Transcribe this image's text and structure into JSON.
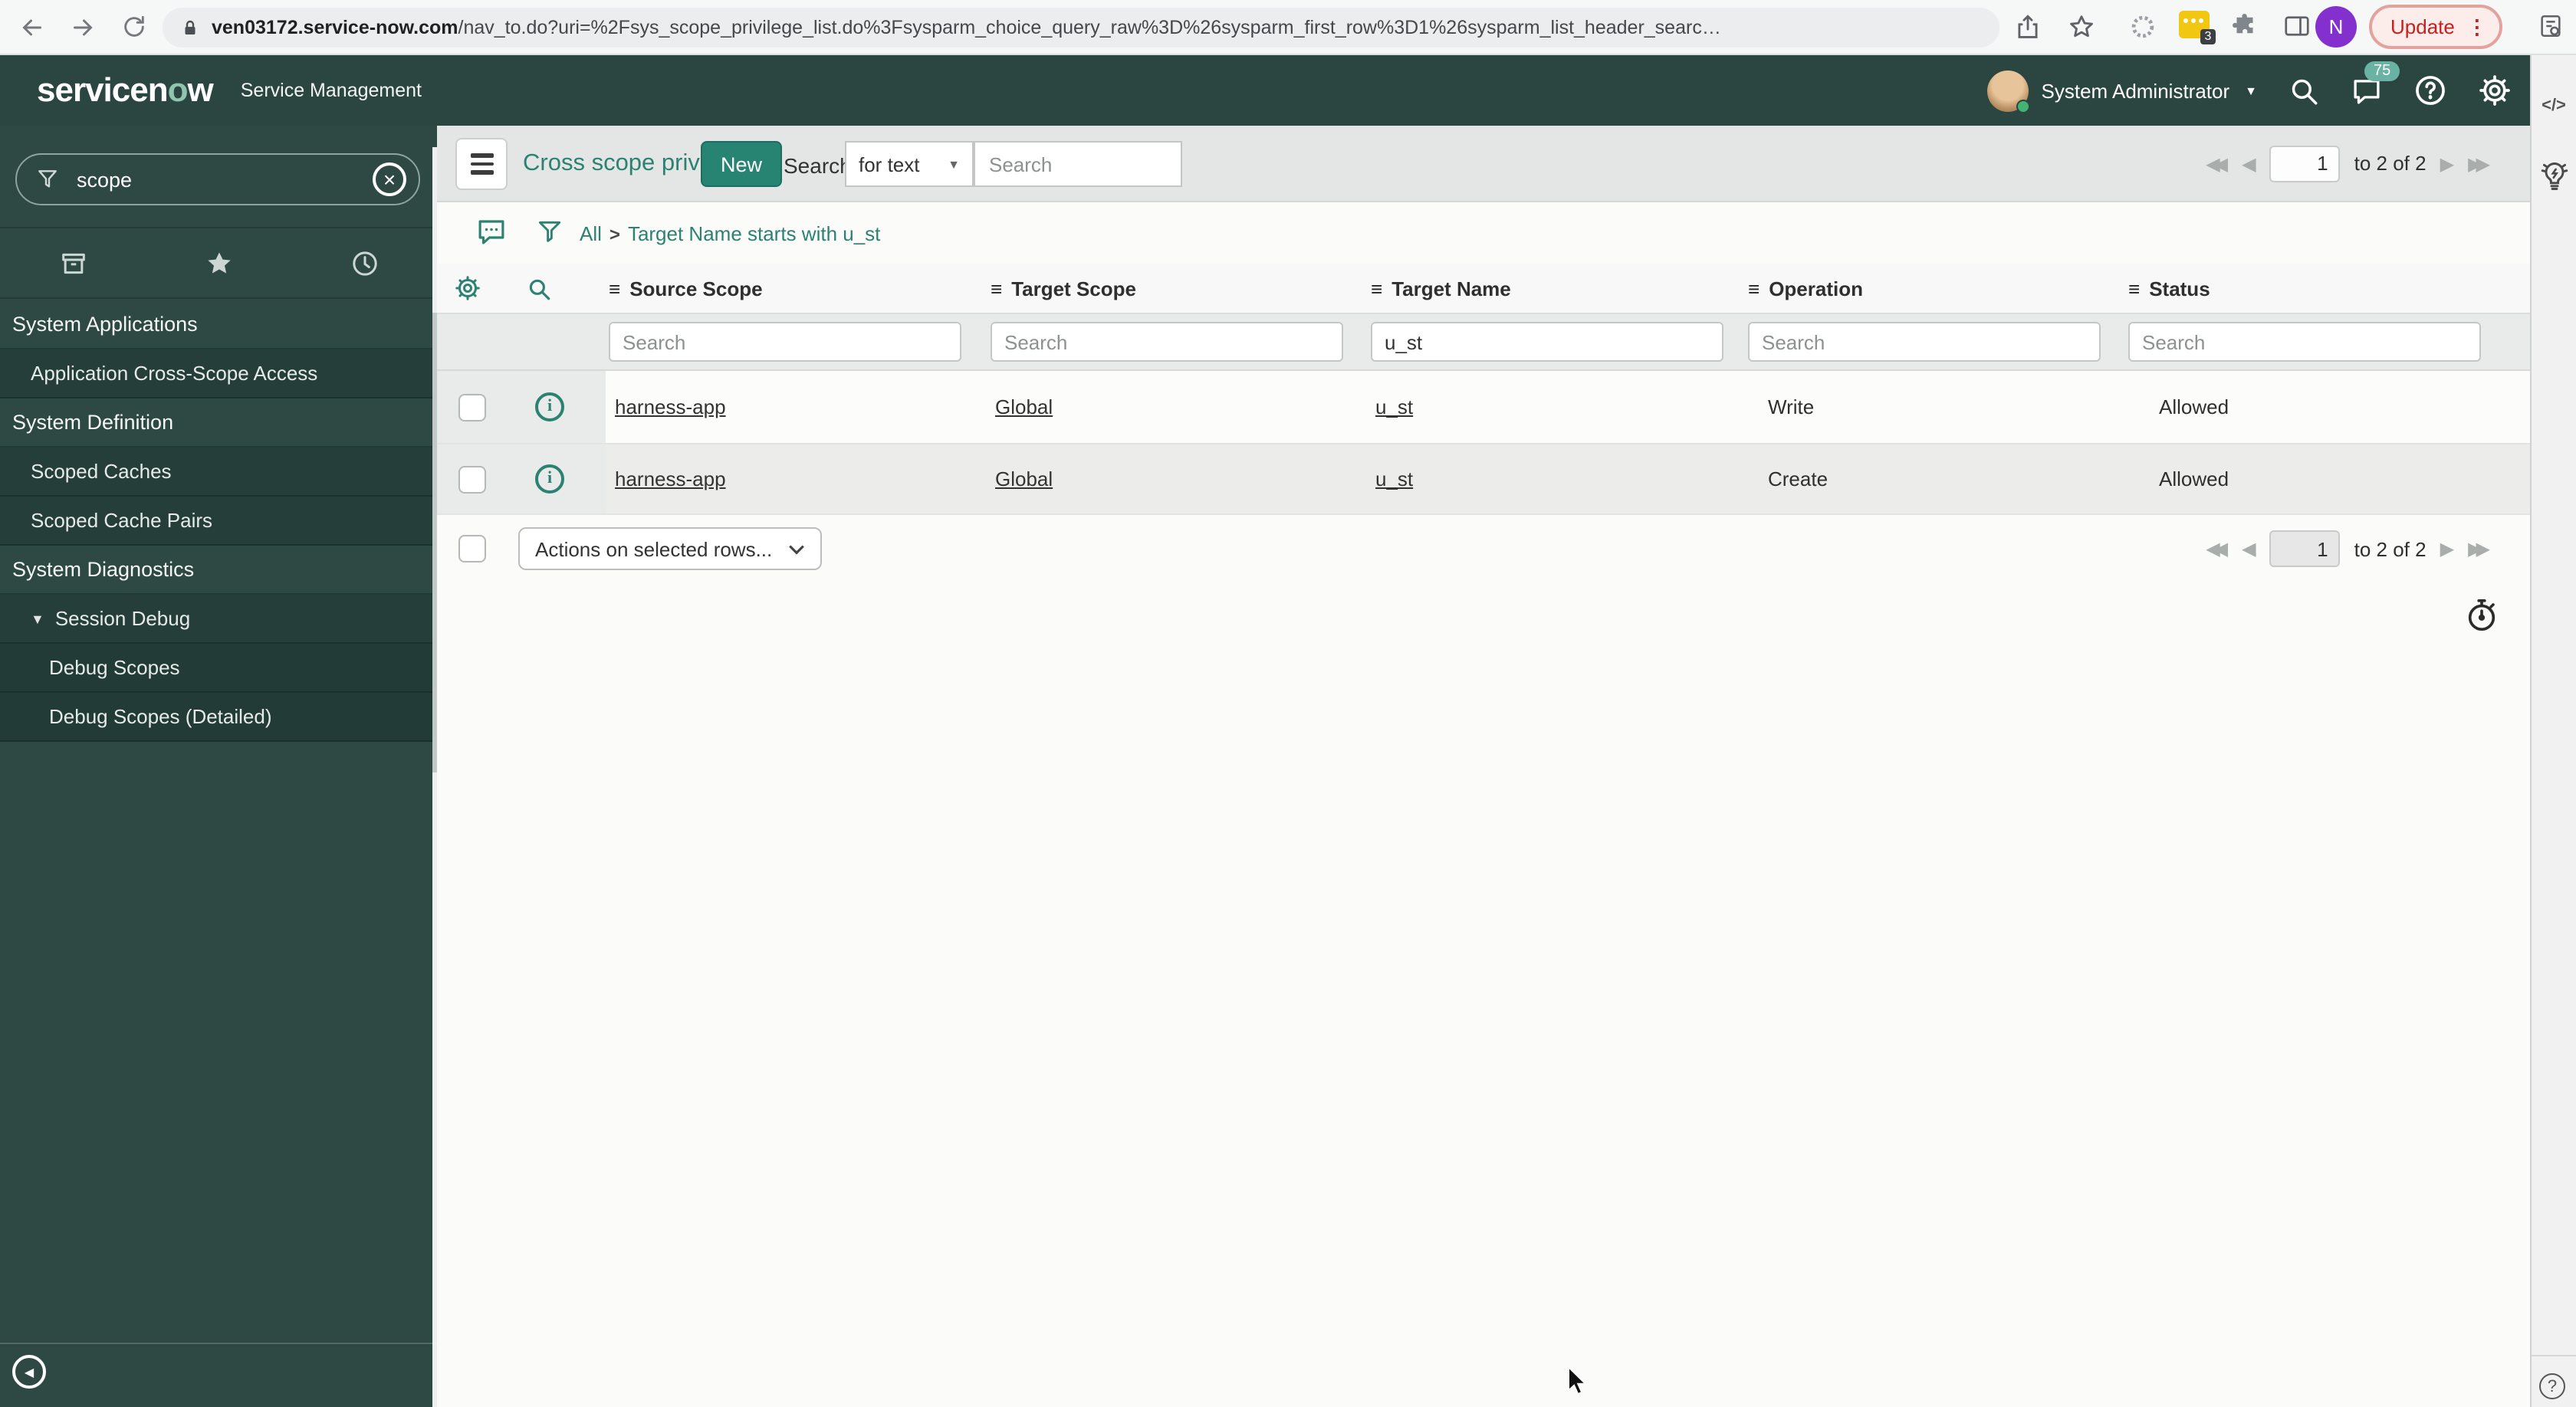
{
  "browser": {
    "url_domain": "ven03172.service-now.com",
    "url_path": "/nav_to.do?uri=%2Fsys_scope_privilege_list.do%3Fsysparm_choice_query_raw%3D%26sysparm_first_row%3D1%26sysparm_list_header_searc…",
    "update_label": "Update",
    "profile_initial": "N",
    "extension_badge": "3"
  },
  "banner": {
    "logo_pre": "servicen",
    "logo_o": "o",
    "logo_w": "w",
    "product": "Service Management",
    "user_name": "System Administrator",
    "notifications_count": "75"
  },
  "sidebar": {
    "filter_value": "scope",
    "items": [
      {
        "label": "System Applications",
        "type": "section"
      },
      {
        "label": "Application Cross-Scope Access",
        "type": "item"
      },
      {
        "label": "System Definition",
        "type": "section"
      },
      {
        "label": "Scoped Caches",
        "type": "item"
      },
      {
        "label": "Scoped Cache Pairs",
        "type": "item"
      },
      {
        "label": "System Diagnostics",
        "type": "section"
      },
      {
        "label": "Session Debug",
        "type": "expanded"
      },
      {
        "label": "Debug Scopes",
        "type": "subitem"
      },
      {
        "label": "Debug Scopes (Detailed)",
        "type": "subitem"
      }
    ]
  },
  "list": {
    "title": "Cross scope privileges",
    "new_button": "New",
    "search_label": "Search",
    "search_mode": "for text",
    "search_placeholder": "Search",
    "breadcrumb": {
      "all": "All",
      "separator": ">",
      "condition": "Target Name starts with u_st"
    },
    "pagination": {
      "page": "1",
      "range": "to 2 of 2"
    },
    "columns": [
      "Source Scope",
      "Target Scope",
      "Target Name",
      "Operation",
      "Status"
    ],
    "filter_values": {
      "source_scope": "",
      "target_scope": "",
      "target_name": "u_st",
      "operation": "",
      "status": ""
    },
    "rows": [
      {
        "source_scope": "harness-app",
        "target_scope": "Global",
        "target_name": "u_st",
        "operation": "Write",
        "status": "Allowed"
      },
      {
        "source_scope": "harness-app",
        "target_scope": "Global",
        "target_name": "u_st",
        "operation": "Create",
        "status": "Allowed"
      }
    ],
    "actions_label": "Actions on selected rows..."
  },
  "icons": {
    "menu_bars": "≡",
    "caret_down": "▼",
    "triangle_down": "▼",
    "triangle_left": "◀",
    "prev": "◀",
    "next": "▶",
    "first": "◀◀",
    "last": "▶▶",
    "kebab": "⋮",
    "close": "×",
    "code": "</>",
    "question": "?",
    "info": "i"
  },
  "colors": {
    "accent": "#278472",
    "banner_bg": "#2b4640",
    "sidebar_bg": "#2e4944",
    "update_red": "#c5221f",
    "badge_teal": "#6ab2a3",
    "row_alt": "#ececeb"
  }
}
